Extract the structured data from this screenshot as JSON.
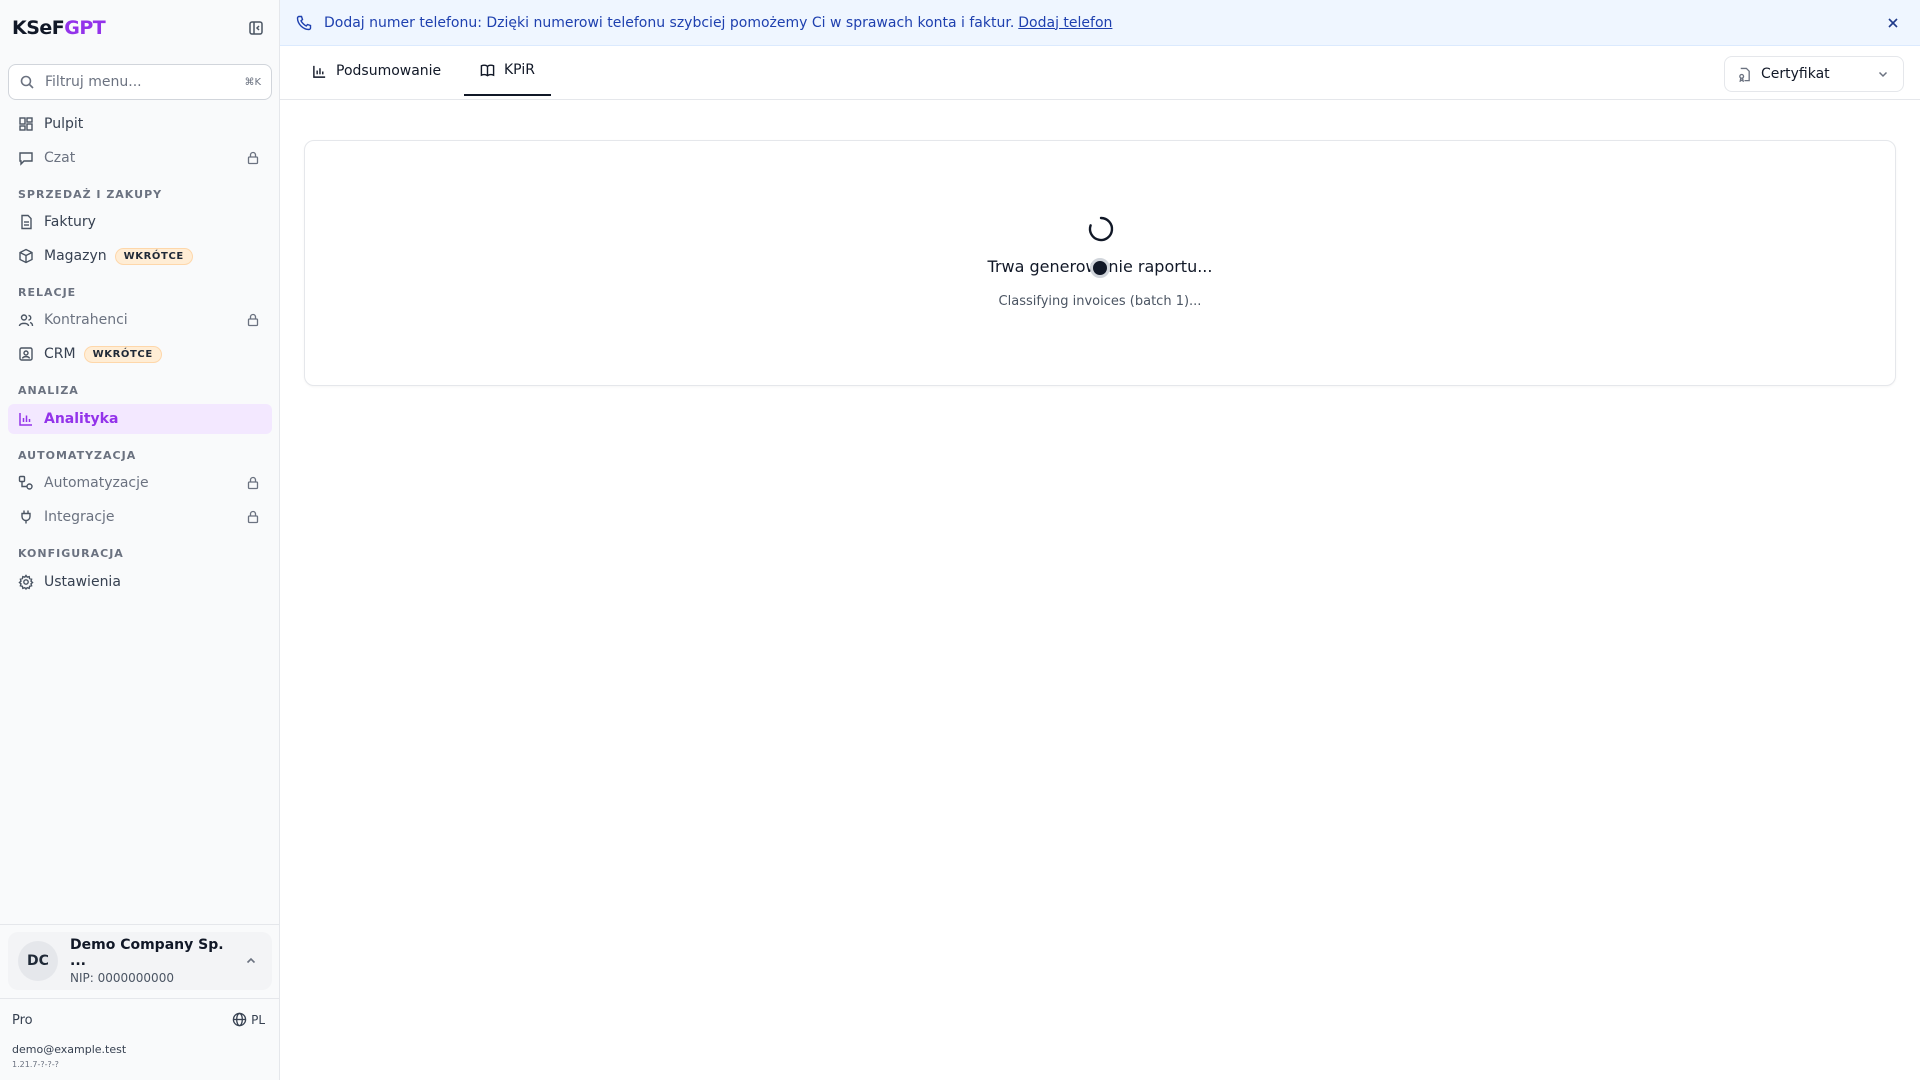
{
  "brand": {
    "part1": "KSeF",
    "part2": "GPT"
  },
  "search": {
    "placeholder": "Filtruj menu...",
    "shortcut": "⌘K"
  },
  "nav": {
    "pulpit": "Pulpit",
    "czat": "Czat",
    "section_sales": "SPRZEDAŻ I ZAKUPY",
    "faktury": "Faktury",
    "magazyn": "Magazyn",
    "magazyn_badge": "WKRÓTCE",
    "section_relations": "RELACJE",
    "kontrahenci": "Kontrahenci",
    "crm": "CRM",
    "crm_badge": "WKRÓTCE",
    "section_analysis": "ANALIZA",
    "analityka": "Analityka",
    "section_automation": "AUTOMATYZACJA",
    "automatyzacje": "Automatyzacje",
    "integracje": "Integracje",
    "section_config": "KONFIGURACJA",
    "ustawienia": "Ustawienia"
  },
  "company": {
    "initials": "DC",
    "name": "Demo Company Sp. ...",
    "nip": "NIP: 0000000000"
  },
  "footer": {
    "plan": "Pro",
    "language": "PL",
    "email": "demo@example.test",
    "version": "1.21.7-?-?-?"
  },
  "banner": {
    "text": "Dodaj numer telefonu: Dzięki numerowi telefonu szybciej pomożemy Ci w sprawach konta i faktur.",
    "link": "Dodaj telefon"
  },
  "tabs": [
    {
      "label": "Podsumowanie"
    },
    {
      "label": "KPiR"
    }
  ],
  "certificate": {
    "label": "Certyfikat"
  },
  "loading": {
    "title": "Trwa generowanie raportu...",
    "subtitle": "Classifying invoices (batch 1)..."
  },
  "colors": {
    "accent": "#9333ea",
    "banner_bg": "#eff6ff",
    "badge_bg": "#ffedd5"
  }
}
